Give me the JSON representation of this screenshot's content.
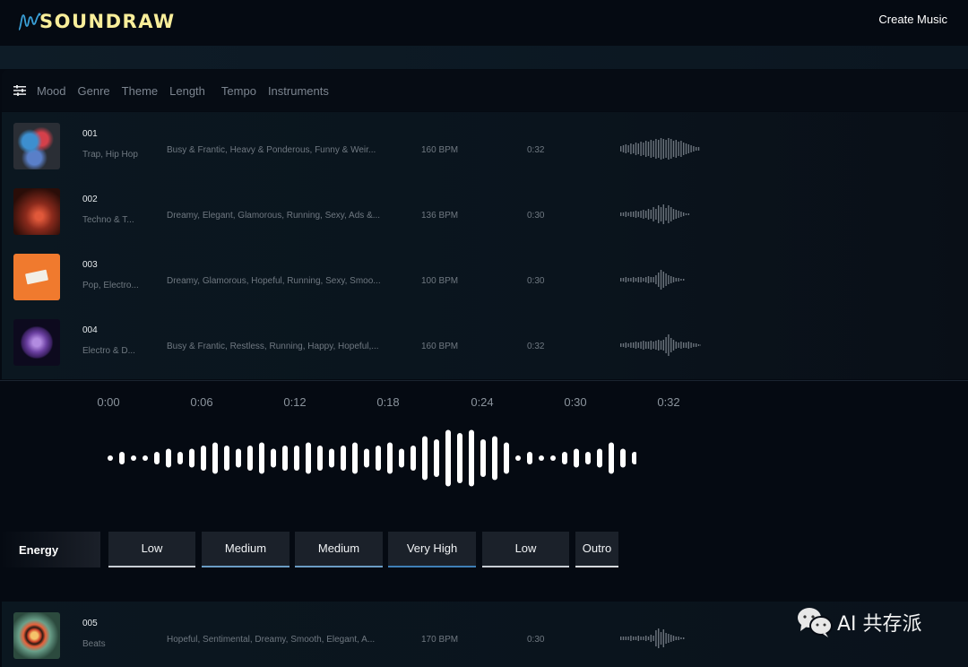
{
  "header": {
    "logo_text": "SOUNDRAW",
    "create_music": "Create Music"
  },
  "filters": {
    "icon": "sliders-icon",
    "items": [
      "Mood",
      "Genre",
      "Theme",
      "Length",
      "Tempo",
      "Instruments"
    ]
  },
  "tracks": [
    {
      "num": "001",
      "genre": "Trap, Hip Hop",
      "moods": "Busy & Frantic, Heavy & Ponderous, Funny & Weir...",
      "bpm": "160 BPM",
      "duration": "0:32",
      "art": "smoke-art",
      "wave": [
        3,
        4,
        5,
        4,
        6,
        5,
        7,
        6,
        8,
        7,
        9,
        8,
        10,
        9,
        11,
        10,
        12,
        11,
        10,
        12,
        11,
        9,
        10,
        8,
        9,
        7,
        6,
        5,
        4,
        3,
        2,
        2
      ]
    },
    {
      "num": "002",
      "genre": "Techno & T...",
      "moods": "Dreamy, Elegant, Glamorous, Running, Sexy, Ads &...",
      "bpm": "136 BPM",
      "duration": "0:30",
      "art": "forest-art",
      "wave": [
        2,
        2,
        3,
        2,
        3,
        3,
        4,
        3,
        4,
        5,
        4,
        6,
        5,
        8,
        6,
        10,
        8,
        11,
        7,
        10,
        8,
        6,
        5,
        4,
        3,
        2,
        1,
        1
      ]
    },
    {
      "num": "003",
      "genre": "Pop, Electro...",
      "moods": "Dreamy, Glamorous, Hopeful, Running, Sexy, Smoo...",
      "bpm": "100 BPM",
      "duration": "0:30",
      "art": "cassette-art",
      "wave": [
        2,
        2,
        3,
        2,
        2,
        3,
        2,
        3,
        3,
        2,
        3,
        4,
        3,
        3,
        5,
        8,
        11,
        9,
        7,
        5,
        4,
        3,
        2,
        2,
        1,
        1
      ]
    },
    {
      "num": "004",
      "genre": "Electro & D...",
      "moods": "Busy & Frantic, Restless, Running, Happy, Hopeful,...",
      "bpm": "160 BPM",
      "duration": "0:32",
      "art": "discoball-art",
      "wave": [
        2,
        2,
        3,
        2,
        3,
        3,
        4,
        3,
        4,
        5,
        4,
        4,
        5,
        4,
        5,
        6,
        5,
        6,
        9,
        12,
        8,
        6,
        4,
        3,
        4,
        3,
        3,
        4,
        3,
        2,
        2,
        1,
        1
      ]
    }
  ],
  "player": {
    "ticks": [
      "0:00",
      "0:06",
      "0:12",
      "0:18",
      "0:24",
      "0:30",
      "0:32"
    ],
    "waveform": [
      1,
      2,
      1,
      1,
      2,
      3,
      2,
      3,
      4,
      5,
      4,
      3,
      4,
      5,
      3,
      4,
      4,
      5,
      4,
      3,
      4,
      5,
      3,
      4,
      5,
      3,
      4,
      7,
      6,
      9,
      8,
      9,
      6,
      7,
      5,
      1,
      2,
      1,
      1,
      2,
      3,
      2,
      3,
      5,
      3,
      2,
      1
    ],
    "energy_label": "Energy",
    "segments": [
      {
        "label": "Low",
        "level": "low"
      },
      {
        "label": "Medium",
        "level": "medium"
      },
      {
        "label": "Medium",
        "level": "medium"
      },
      {
        "label": "Very High",
        "level": "very-high"
      },
      {
        "label": "Low",
        "level": "low"
      },
      {
        "label": "Outro",
        "level": "outro"
      }
    ],
    "level_colors": {
      "low": "#c9ced4",
      "medium": "#6b9cc4",
      "very-high": "#3f7fb6",
      "outro": "#d6d9dc"
    }
  },
  "track5": {
    "num": "005",
    "genre": "Beats",
    "moods": "Hopeful, Sentimental, Dreamy, Smooth, Elegant, A...",
    "bpm": "170 BPM",
    "duration": "0:30",
    "art": "swirl-art",
    "wave": [
      2,
      2,
      2,
      2,
      3,
      2,
      2,
      3,
      2,
      2,
      3,
      2,
      4,
      3,
      9,
      11,
      7,
      10,
      6,
      5,
      4,
      3,
      2,
      2,
      1,
      1
    ]
  },
  "watermark": {
    "icon": "wechat-icon",
    "text": "AI 共存派"
  }
}
